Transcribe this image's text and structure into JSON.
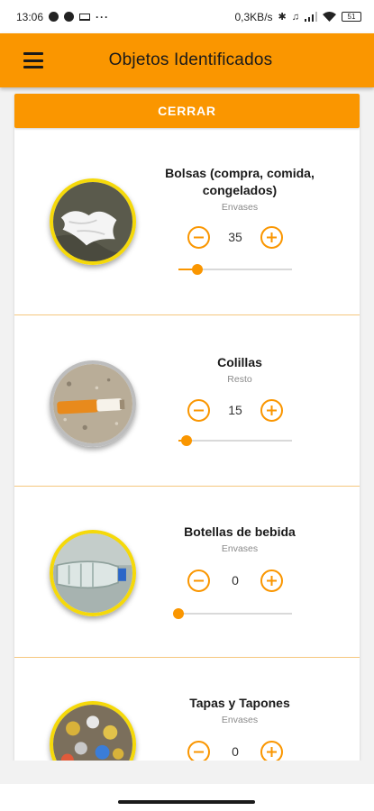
{
  "status_bar": {
    "time": "13:06",
    "network_speed": "0,3KB/s",
    "battery": "51"
  },
  "app_bar": {
    "title": "Objetos Identificados"
  },
  "close_button": {
    "label": "CERRAR"
  },
  "items": [
    {
      "name": "Bolsas (compra, comida, congelados)",
      "category": "Envases",
      "count": "35",
      "slider_fraction": 0.17,
      "image_icon": "plastic-bag"
    },
    {
      "name": "Colillas",
      "category": "Resto",
      "count": "15",
      "slider_fraction": 0.07,
      "image_icon": "cigarette-butt"
    },
    {
      "name": "Botellas de bebida",
      "category": "Envases",
      "count": "0",
      "slider_fraction": 0.0,
      "image_icon": "plastic-bottle"
    },
    {
      "name": "Tapas y Tapones",
      "category": "Envases",
      "count": "0",
      "slider_fraction": 0.0,
      "image_icon": "bottle-caps"
    }
  ],
  "colors": {
    "accent": "#fa9600",
    "thumb_border_yellow": "#f5d90a",
    "thumb_border_grey": "#bdbdbd",
    "divider": "#f5c77e"
  }
}
